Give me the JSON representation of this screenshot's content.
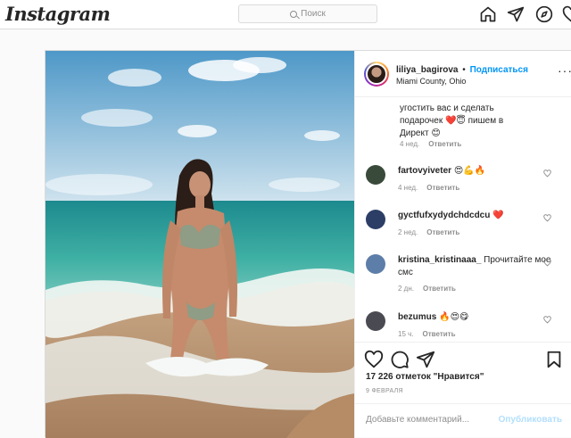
{
  "header": {
    "logo": "Instagram",
    "search_placeholder": "Поиск"
  },
  "post": {
    "username": "liliya_bagirova",
    "separator": "•",
    "follow_label": "Подписаться",
    "location": "Miami County, Ohio",
    "more_label": "···",
    "caption_tail": "угостить вас и сделать подарочек ❤️😇 пишем в Директ 😊",
    "caption_time": "4 нед.",
    "reply_label": "Ответить",
    "comments": [
      {
        "username": "fartovyiveter",
        "text": "😍💪🔥",
        "time": "4 нед.",
        "reply": "Ответить",
        "avatar_color": "#3a4a3a"
      },
      {
        "username": "gyctfufxydydchdcdcu",
        "text": "❤️",
        "time": "2 нед.",
        "reply": "Ответить",
        "avatar_color": "#2c3e66"
      },
      {
        "username": "kristina_kristinaaa_",
        "text": "Прочитайте мое смс",
        "time": "2 дн.",
        "reply": "Ответить",
        "avatar_color": "#5d7ea8"
      },
      {
        "username": "bezumus",
        "text": "🔥😍😋",
        "time": "15 ч.",
        "reply": "Ответить",
        "avatar_color": "#4a4a52"
      }
    ],
    "likes_text": "17 226 отметок \"Нравится\"",
    "date": "9 ФЕВРАЛЯ",
    "add_comment_placeholder": "Добавьте комментарий...",
    "publish_label": "Опубликовать"
  },
  "colors": {
    "accent": "#0095f6",
    "like_red": "#ed4956",
    "border": "#dbdbdb"
  }
}
